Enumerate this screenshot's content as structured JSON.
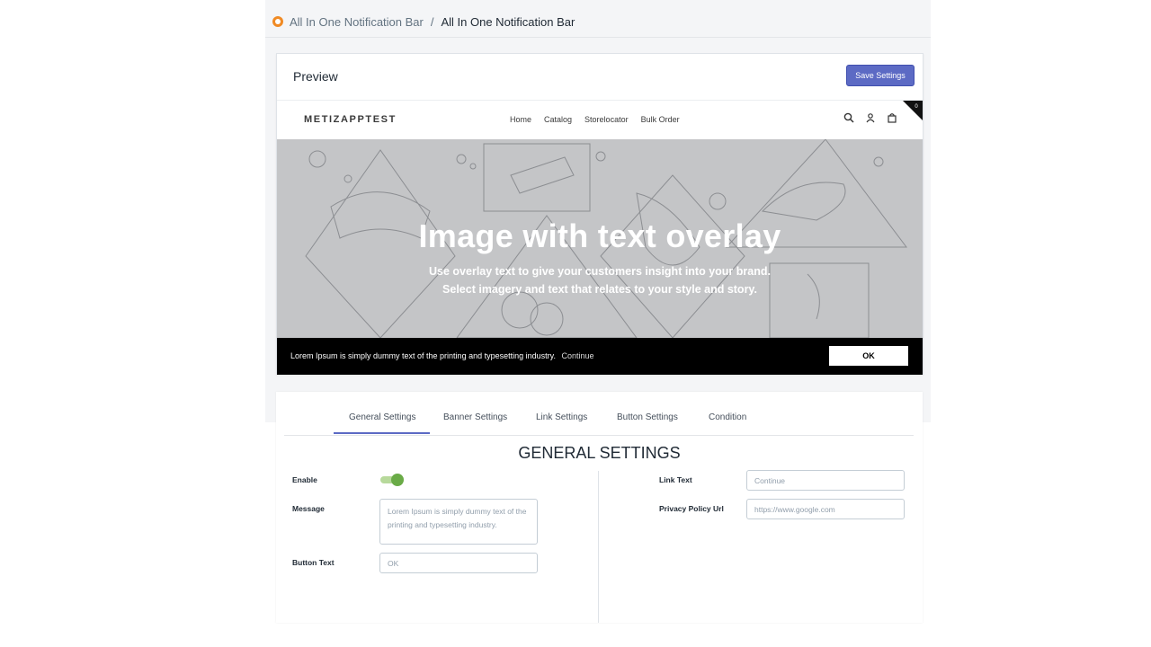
{
  "breadcrumb": {
    "app_name": "All In One Notification Bar",
    "current": "All In One Notification Bar",
    "separator": "/"
  },
  "preview": {
    "title": "Preview",
    "save_button": "Save Settings"
  },
  "store": {
    "logo": "METIZAPPTEST",
    "menu": [
      "Home",
      "Catalog",
      "Storelocator",
      "Bulk Order"
    ],
    "badge_count": "0",
    "hero_title": "Image with text overlay",
    "hero_sub_line1": "Use overlay text to give your customers insight into your brand.",
    "hero_sub_line2": "Select imagery and text that relates to your style and story."
  },
  "notification_bar": {
    "message": "Lorem Ipsum is simply dummy text of the printing and typesetting industry.",
    "link_text": "Continue",
    "button_text": "OK",
    "background": "#000000"
  },
  "settings": {
    "tabs": [
      "General Settings",
      "Banner Settings",
      "Link Settings",
      "Button Settings",
      "Condition"
    ],
    "active_tab": "General Settings",
    "section_title": "GENERAL SETTINGS",
    "enable_label": "Enable",
    "enable_on": true,
    "message_label": "Message",
    "message_value": "Lorem Ipsum is simply dummy text of the printing and typesetting industry.",
    "button_text_label": "Button Text",
    "button_text_value": "OK",
    "link_text_label": "Link Text",
    "link_text_value": "Continue",
    "privacy_label": "Privacy Policy Url",
    "privacy_value": "https://www.google.com"
  },
  "colors": {
    "accent": "#5c6ac4",
    "toggle_on": "#6aab47",
    "hero_bg": "#c4c5c7"
  }
}
